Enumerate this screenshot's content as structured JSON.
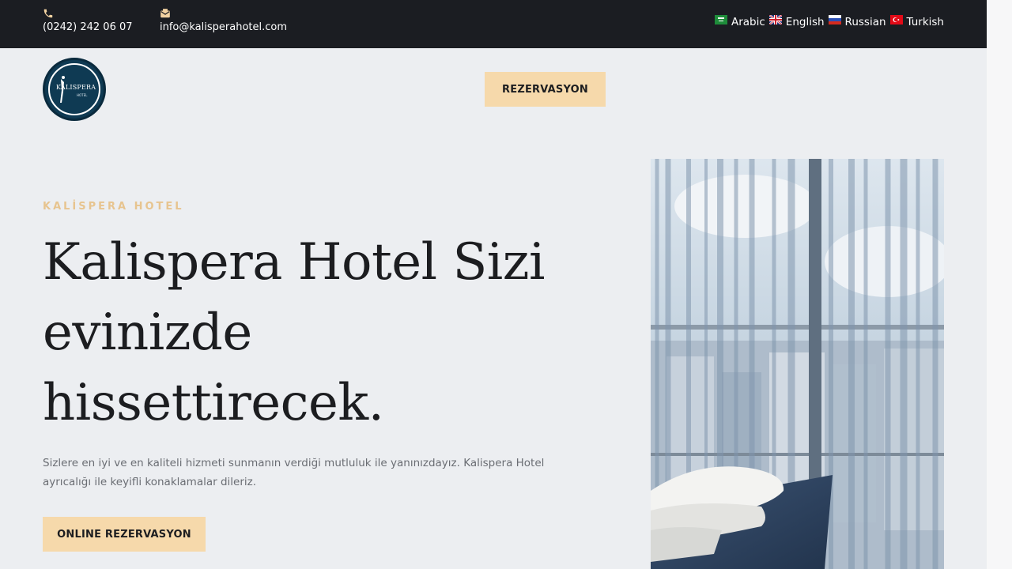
{
  "topbar": {
    "phone": "(0242) 242 06 07",
    "phone_icon": "phone-icon",
    "email": "info@kalisperahotel.com",
    "email_icon": "mail-icon",
    "languages": [
      {
        "label": "Arabic",
        "flag": "flag-sa-icon"
      },
      {
        "label": "English",
        "flag": "flag-gb-icon"
      },
      {
        "label": "Russian",
        "flag": "flag-ru-icon"
      },
      {
        "label": "Turkish",
        "flag": "flag-tr-icon"
      }
    ]
  },
  "header": {
    "logo_text": "KALISPERA",
    "logo_sub": "HOTEL",
    "reserve_label": "REZERVASYON"
  },
  "hero": {
    "eyebrow": "KALİSPERA HOTEL",
    "headline": "Kalispera Hotel Sizi evinizde hissettirecek.",
    "lead": "Sizlere en iyi ve en kaliteli hizmeti sunmanın verdiği mutluluk ile yanınızdayız. Kalispera Hotel ayrıcalığı ile keyifli konaklamalar dileriz.",
    "cta_label": "ONLINE REZERVASYON",
    "image": "hotel-room-window-photo"
  },
  "colors": {
    "topbar": "#1b1d22",
    "page": "#eceef1",
    "accent": "#f6d9ab",
    "eyebrow": "#e7c48f",
    "logo": "#0f3a53"
  }
}
